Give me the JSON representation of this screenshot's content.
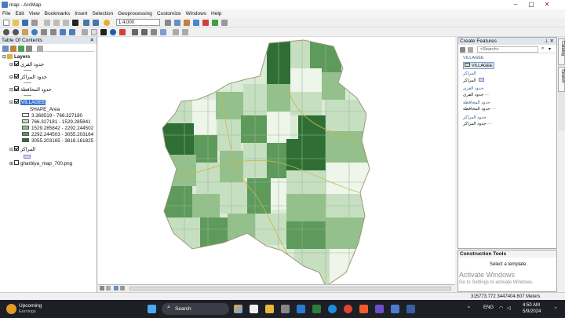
{
  "window": {
    "title": "map - ArcMap"
  },
  "menu": [
    "File",
    "Edit",
    "View",
    "Bookmarks",
    "Insert",
    "Selection",
    "Geoprocessing",
    "Customize",
    "Windows",
    "Help"
  ],
  "toolbar": {
    "scale": "1:4,000"
  },
  "toc": {
    "title": "Table Of Contents",
    "root": "Layers",
    "layers": [
      "حدود القرى",
      "حدود المراكز",
      "حدود المحافظة",
      "VILLAGEE",
      "المراكز",
      "gharbiya_map_700.png"
    ],
    "legend_field": "SHAPE_Area",
    "legend_classes": [
      {
        "label": "3.368519 - 766.327180",
        "color": "#eef5ea"
      },
      {
        "label": "766.327181 - 1529.285841",
        "color": "#c6dfc0"
      },
      {
        "label": "1529.285842 - 2292.244502",
        "color": "#94c08c"
      },
      {
        "label": "2292.244503 - 3055.203164",
        "color": "#5d9a5b"
      },
      {
        "label": "3055.203165 - 3818.161825",
        "color": "#2f6f35"
      }
    ]
  },
  "create_features": {
    "title": "Create Features",
    "search_placeholder": "<Search>",
    "items": [
      "VILLAGEE",
      "VILLAGEE",
      "المراكز",
      "المراكز",
      "حدود القرى",
      "حدود القرى",
      "حدود المحافظة",
      "حدود المحافظة",
      "حدود المراكز",
      "حدود المراكز"
    ]
  },
  "construction_tools": {
    "title": "Construction Tools",
    "hint": "Select a template."
  },
  "watermark": {
    "line1": "Activate Windows",
    "line2": "Go to Settings to activate Windows."
  },
  "side_tabs": [
    "Catalog",
    "Search"
  ],
  "status": {
    "coords": "315773.772  3447404.607 Meters"
  },
  "taskbar": {
    "weather_title": "Upcoming",
    "weather_sub": "Earnings",
    "search": "Search",
    "lang": "ENG",
    "time": "4:50 AM",
    "date": "5/9/2024"
  }
}
